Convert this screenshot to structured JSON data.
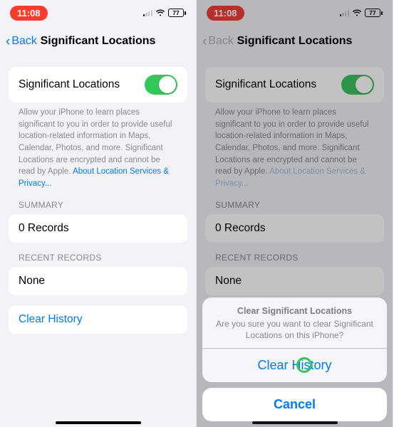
{
  "status": {
    "time": "11:08",
    "battery": "77"
  },
  "nav": {
    "back": "Back",
    "title": "Significant Locations"
  },
  "toggle_row": {
    "label": "Significant Locations"
  },
  "caption": {
    "text": "Allow your iPhone to learn places significant to you in order to provide useful location-related information in Maps, Calendar, Photos, and more. Significant Locations are encrypted and cannot be read by Apple.",
    "link": "About Location Services & Privacy..."
  },
  "sections": {
    "summary": {
      "header": "SUMMARY",
      "value": "0 Records"
    },
    "recent": {
      "header": "RECENT RECORDS",
      "value": "None"
    }
  },
  "clear_row": {
    "label": "Clear History"
  },
  "sheet": {
    "title": "Clear Significant Locations",
    "message": "Are you sure you want to clear Significant Locations on this iPhone?",
    "confirm": "Clear History",
    "cancel": "Cancel"
  }
}
